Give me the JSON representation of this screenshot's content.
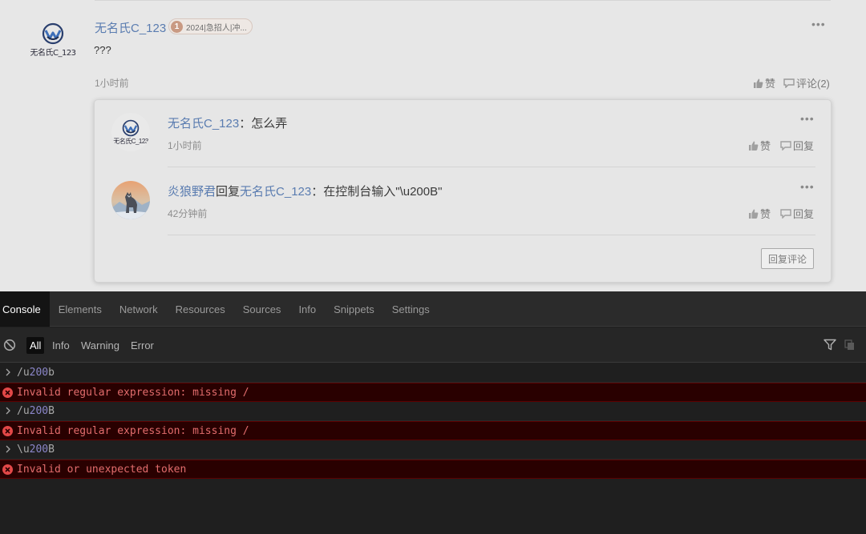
{
  "post": {
    "author": "无名氏C_123",
    "avatar_caption": "无名氏C_123",
    "badge_level": "1",
    "badge_text": "2024|急招人|冲...",
    "content": "???",
    "time": "1小时前",
    "like_label": "赞",
    "comment_label": "评论(2)"
  },
  "replies": [
    {
      "author": "无名氏C_123",
      "avatar_caption": "无名氏C_123",
      "separator": "：",
      "text": "怎么弄",
      "time": "1小时前",
      "like_label": "赞",
      "reply_label": "回复"
    },
    {
      "author": "炎狼野君",
      "reply_word": "回复",
      "target": "无名氏C_123",
      "separator": "：",
      "text": "在控制台输入\"\\u200B\"",
      "time": "42分钟前",
      "like_label": "赞",
      "reply_label": "回复"
    }
  ],
  "reply_comment_button": "回复评论",
  "devtools": {
    "tabs": [
      "Console",
      "Elements",
      "Network",
      "Resources",
      "Sources",
      "Info",
      "Snippets",
      "Settings"
    ],
    "active_tab": "Console",
    "filters": [
      "All",
      "Info",
      "Warning",
      "Error"
    ],
    "active_filter": "All",
    "console": [
      {
        "type": "input",
        "pre": "/u",
        "hl": "200",
        "post": "b"
      },
      {
        "type": "error",
        "text": "Invalid regular expression: missing /"
      },
      {
        "type": "input",
        "pre": "/u",
        "hl": "200",
        "post": "B"
      },
      {
        "type": "error",
        "text": "Invalid regular expression: missing /"
      },
      {
        "type": "input",
        "pre": "\\u",
        "hl": "200",
        "post": "B"
      },
      {
        "type": "error",
        "text": "Invalid or unexpected token"
      }
    ]
  },
  "colors": {
    "link": "#5a7cb0",
    "error_bg": "#290000",
    "error_text": "#e26d6d",
    "number_highlight": "#8b86c9"
  }
}
